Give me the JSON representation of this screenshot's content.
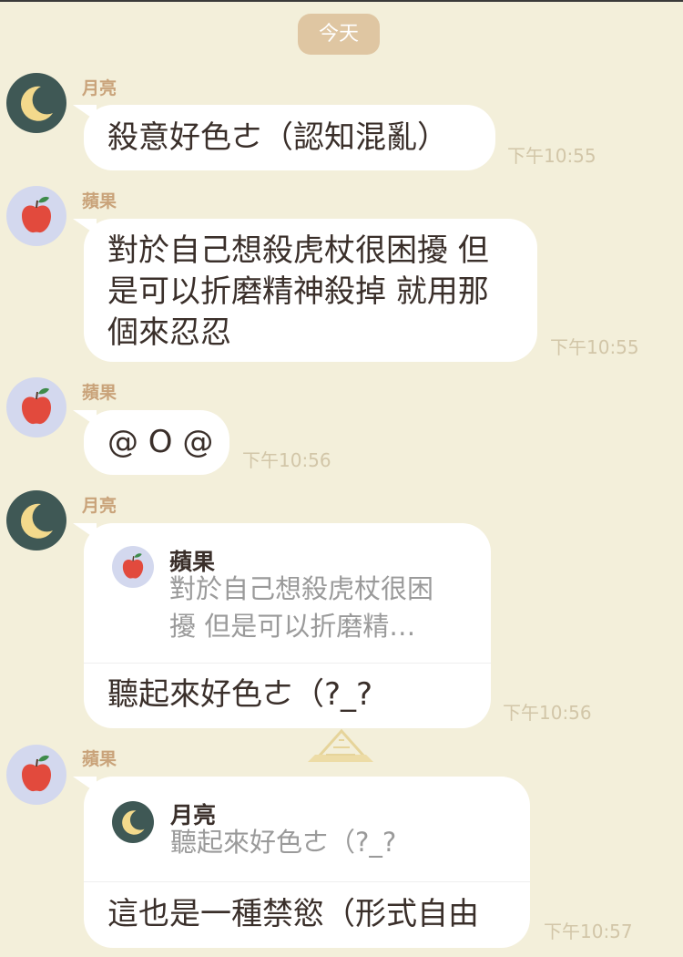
{
  "date_divider": "今天",
  "messages": [
    {
      "sender": "月亮",
      "avatar_icon": "moon-icon",
      "lines": [
        "殺意好色ㄜ（認知混亂）"
      ],
      "time": "下午10:55"
    },
    {
      "sender": "蘋果",
      "avatar_icon": "apple-icon",
      "lines": [
        "對於自己想殺虎杖很困擾 但",
        "是可以折磨精神殺掉 就用那",
        "個來忍忍"
      ],
      "time": "下午10:55"
    },
    {
      "sender": "蘋果",
      "avatar_icon": "apple-icon",
      "lines": [
        "@ O @"
      ],
      "time": "下午10:56"
    },
    {
      "sender": "月亮",
      "avatar_icon": "moon-icon",
      "quote": {
        "name": "蘋果",
        "avatar_icon": "apple-icon",
        "lines": [
          "對於自己想殺虎杖很困",
          "擾 但是可以折磨精…"
        ]
      },
      "lines": [
        "聽起來好色ㄜ（?_?"
      ],
      "time": "下午10:56"
    },
    {
      "sender": "蘋果",
      "avatar_icon": "apple-icon",
      "quote": {
        "name": "月亮",
        "avatar_icon": "moon-icon",
        "lines": [
          "聽起來好色ㄜ（?_?"
        ]
      },
      "lines": [
        "這也是一種禁慾（形式自由"
      ],
      "time": "下午10:57"
    }
  ],
  "colors": {
    "background": "#f3efda",
    "bubble": "#ffffff",
    "sender_name": "#c9a37a",
    "timestamp": "#d2c6a8",
    "date_pill": "#dfc6a2",
    "moon_avatar_bg": "#3f5855",
    "apple_avatar_bg": "#d3d8ee"
  }
}
